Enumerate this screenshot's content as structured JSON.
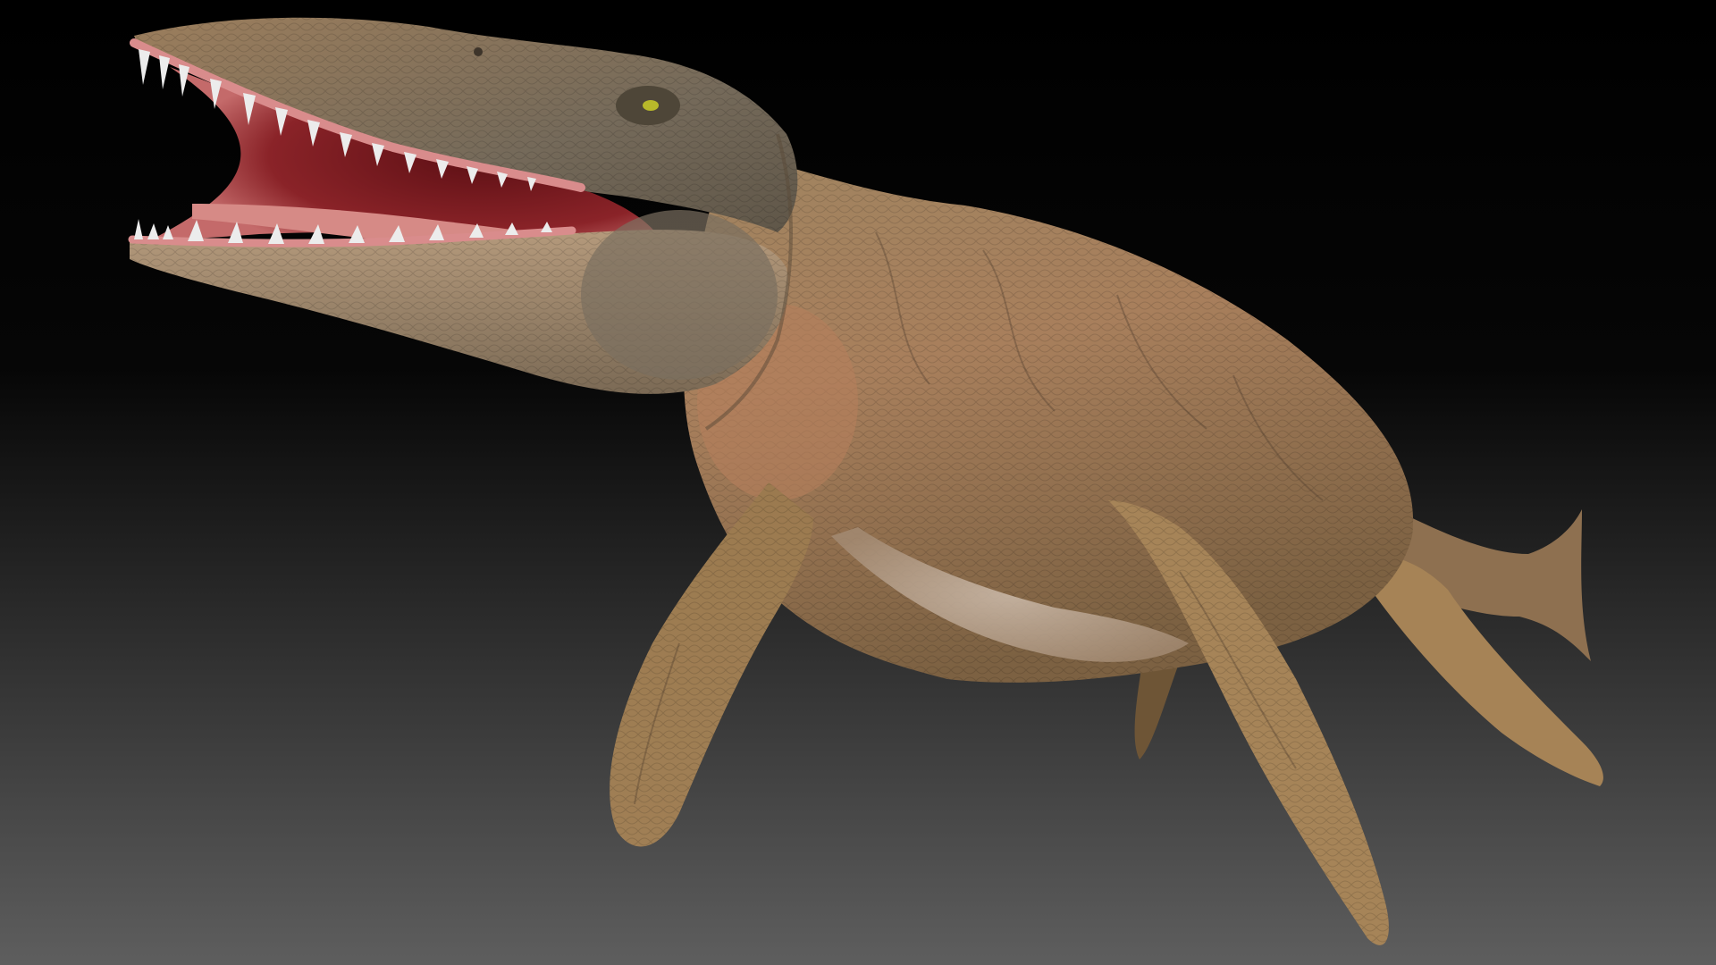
{
  "scene": {
    "subject": "marine-reptile-render",
    "colors": {
      "background_top": "#000000",
      "background_bottom": "#5e5e5e",
      "skin_light": "#b09066",
      "skin_mid": "#8f7048",
      "skin_dark": "#5e4a33",
      "head_grey": "#6f6556",
      "belly": "#c9b7a6",
      "mouth_inner": "#7a1f22",
      "gums": "#d98c8c",
      "tongue": "#d68a86",
      "teeth": "#ececec",
      "eye": "#b8b82a"
    }
  }
}
